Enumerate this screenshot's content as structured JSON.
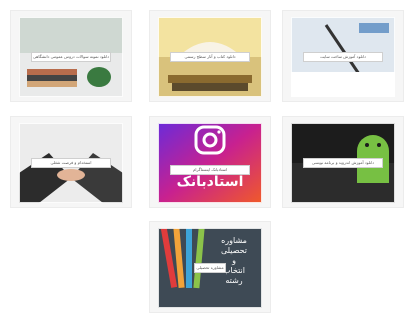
{
  "cards": [
    {
      "caption": "دانلود آموزش ساخت سایت"
    },
    {
      "caption": "دانلود کتاب و آثار سطح رسمی"
    },
    {
      "caption": "دانلود نمونه سوالات دروس عمومی دانشگاهی"
    },
    {
      "caption": "دانلود آموزش اندروید و برنامه نویسی"
    },
    {
      "caption": "استادبانک اینستاگرام"
    },
    {
      "caption": "استخدام و فرصت شغلی"
    },
    {
      "caption": "مشاوره تحصیلی"
    }
  ],
  "instagram": {
    "brand": "استادبانک"
  },
  "poster": {
    "line1": "مشاوره",
    "line2": "تحصیلی",
    "line3": "و",
    "line4": "انتخاب",
    "line5": "رشته"
  }
}
